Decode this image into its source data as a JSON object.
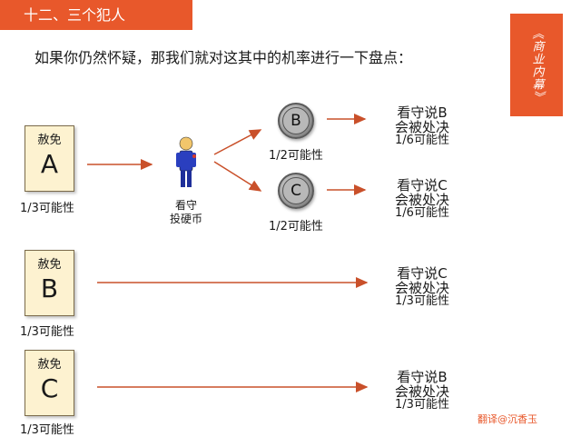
{
  "header": {
    "title": "十二、三个犯人",
    "side_tag": "《商业内幕》"
  },
  "subtitle": "如果你仍然怀疑，那我们就对这其中的机率进行一下盘点：",
  "cards": [
    {
      "label": "赦免",
      "letter": "A",
      "prob": "1/3可能性"
    },
    {
      "label": "赦免",
      "letter": "B",
      "prob": "1/3可能性"
    },
    {
      "label": "赦免",
      "letter": "C",
      "prob": "1/3可能性"
    }
  ],
  "guard": {
    "line1": "看守",
    "line2": "投硬币"
  },
  "coins": [
    {
      "letter": "B",
      "prob": "1/2可能性"
    },
    {
      "letter": "C",
      "prob": "1/2可能性"
    }
  ],
  "outcomes": [
    {
      "line1": "看守说B",
      "line2": "会被处决",
      "prob": "1/6可能性"
    },
    {
      "line1": "看守说C",
      "line2": "会被处决",
      "prob": "1/6可能性"
    },
    {
      "line1": "看守说C",
      "line2": "会被处决",
      "prob": "1/3可能性"
    },
    {
      "line1": "看守说B",
      "line2": "会被处决",
      "prob": "1/3可能性"
    }
  ],
  "credit": "翻译@沉香玉",
  "colors": {
    "accent": "#e8582b",
    "arrow": "#c9502a",
    "card_bg": "#fdf2d0"
  }
}
